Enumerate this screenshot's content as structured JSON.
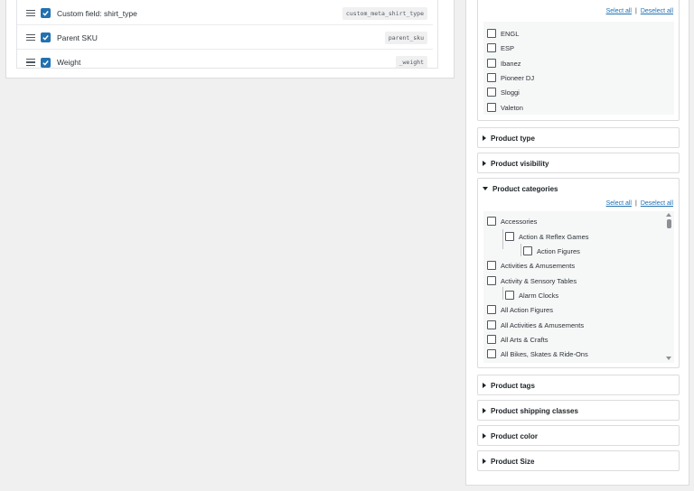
{
  "left": {
    "fields": [
      {
        "label": "Custom field: shirt_type",
        "key": "custom_meta_shirt_type",
        "checked": true
      },
      {
        "label": "Parent SKU",
        "key": "parent_sku",
        "checked": true
      },
      {
        "label": "Weight",
        "key": "_weight",
        "checked": true
      }
    ]
  },
  "right": {
    "top_links": {
      "select_all": "Select all",
      "sep": "|",
      "deselect_all": "Deselect all"
    },
    "brands": [
      "ENGL",
      "ESP",
      "Ibanez",
      "Pioneer DJ",
      "Sloggi",
      "Valeton"
    ],
    "sections": {
      "product_type": "Product type",
      "product_visibility": "Product visibility",
      "product_categories": "Product categories",
      "product_tags": "Product tags",
      "product_shipping_classes": "Product shipping classes",
      "product_color": "Product color",
      "product_size": "Product Size"
    },
    "cat_links": {
      "select_all": "Select all",
      "sep": "|",
      "deselect_all": "Deselect all"
    },
    "categories": [
      "Accessories",
      "Action & Reflex Games",
      "Action Figures",
      "Activities & Amusements",
      "Activity & Sensory Tables",
      "Alarm Clocks",
      "All Action Figures",
      "All Activities & Amusements",
      "All Arts & Crafts",
      "All Bikes, Skates & Ride-Ons"
    ]
  },
  "colors": {
    "accent": "#2271b1",
    "border": "#dcdcde",
    "bg": "#f0f0f1"
  }
}
